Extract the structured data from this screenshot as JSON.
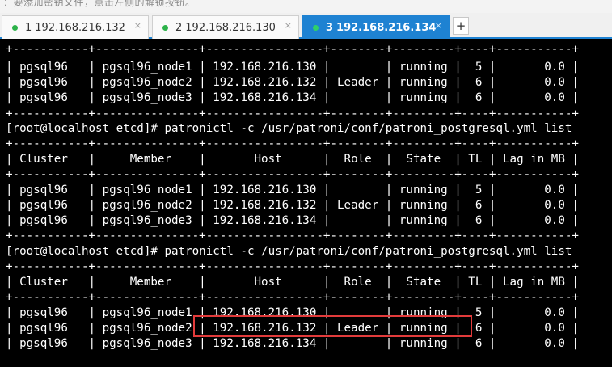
{
  "top_strip": {
    "text": "：要添加密钥文件，点击左侧的解锁按钮。"
  },
  "tabs": [
    {
      "number": "1",
      "label": "192.168.216.132",
      "active": false
    },
    {
      "number": "2",
      "label": "192.168.216.130",
      "active": false
    },
    {
      "number": "3",
      "label": "192.168.216.134",
      "active": true
    }
  ],
  "tab_close_glyph": "×",
  "add_tab_glyph": "+",
  "colors": {
    "tab_active": "#1e82d2",
    "status_dot": "#2db24a",
    "highlight": "#e23b3b"
  },
  "terminal": {
    "lines": [
      "+-----------+---------------+-----------------+--------+---------+----+-----------+",
      "| pgsql96   | pgsql96_node1 | 192.168.216.130 |        | running |  5 |       0.0 |",
      "| pgsql96   | pgsql96_node2 | 192.168.216.132 | Leader | running |  6 |       0.0 |",
      "| pgsql96   | pgsql96_node3 | 192.168.216.134 |        | running |  6 |       0.0 |",
      "+-----------+---------------+-----------------+--------+---------+----+-----------+",
      "[root@localhost etcd]# patronictl -c /usr/patroni/conf/patroni_postgresql.yml list",
      "+-----------+---------------+-----------------+--------+---------+----+-----------+",
      "| Cluster   |     Member    |       Host      |  Role  |  State  | TL | Lag in MB |",
      "+-----------+---------------+-----------------+--------+---------+----+-----------+",
      "| pgsql96   | pgsql96_node1 | 192.168.216.130 |        | running |  5 |       0.0 |",
      "| pgsql96   | pgsql96_node2 | 192.168.216.132 | Leader | running |  6 |       0.0 |",
      "| pgsql96   | pgsql96_node3 | 192.168.216.134 |        | running |  6 |       0.0 |",
      "+-----------+---------------+-----------------+--------+---------+----+-----------+",
      "[root@localhost etcd]# patronictl -c /usr/patroni/conf/patroni_postgresql.yml list",
      "+-----------+---------------+-----------------+--------+---------+----+-----------+",
      "| Cluster   |     Member    |       Host      |  Role  |  State  | TL | Lag in MB |",
      "+-----------+---------------+-----------------+--------+---------+----+-----------+",
      "| pgsql96   | pgsql96_node1 | 192.168.216.130 |        | running |  5 |       0.0 |",
      "| pgsql96   | pgsql96_node2 | 192.168.216.132 | Leader | running |  6 |       0.0 |",
      "| pgsql96   | pgsql96_node3 | 192.168.216.134 |        | running |  6 |       0.0 |"
    ]
  }
}
